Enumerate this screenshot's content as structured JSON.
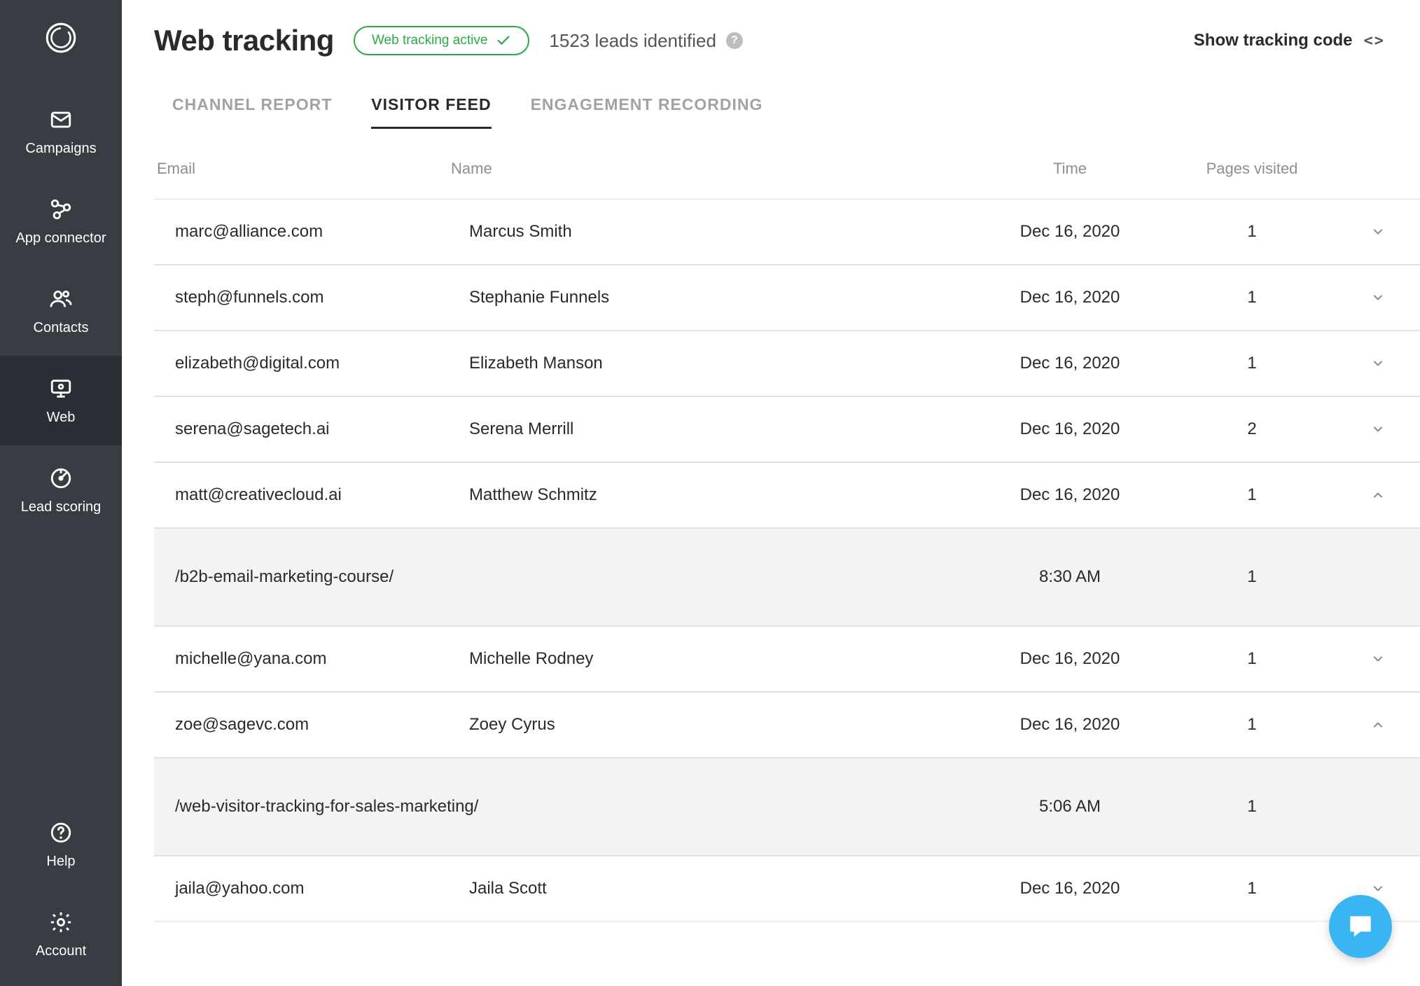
{
  "sidebar": {
    "items": [
      {
        "id": "campaigns",
        "label": "Campaigns"
      },
      {
        "id": "app-connector",
        "label": "App connector"
      },
      {
        "id": "contacts",
        "label": "Contacts"
      },
      {
        "id": "web",
        "label": "Web",
        "active": true
      },
      {
        "id": "lead-scoring",
        "label": "Lead scoring"
      }
    ],
    "bottom": [
      {
        "id": "help",
        "label": "Help"
      },
      {
        "id": "account",
        "label": "Account"
      }
    ]
  },
  "header": {
    "title": "Web tracking",
    "status_text": "Web tracking active",
    "leads_text": "1523 leads identified",
    "show_code_label": "Show tracking code"
  },
  "tabs": [
    {
      "id": "channel-report",
      "label": "CHANNEL REPORT"
    },
    {
      "id": "visitor-feed",
      "label": "VISITOR FEED",
      "active": true
    },
    {
      "id": "engagement-recording",
      "label": "ENGAGEMENT RECORDING"
    }
  ],
  "columns": {
    "email": "Email",
    "name": "Name",
    "time": "Time",
    "pages": "Pages visited"
  },
  "rows": [
    {
      "email": "marc@alliance.com",
      "name": "Marcus Smith",
      "time": "Dec 16, 2020",
      "pages": "1",
      "expanded": false
    },
    {
      "email": "steph@funnels.com",
      "name": "Stephanie Funnels",
      "time": "Dec 16, 2020",
      "pages": "1",
      "expanded": false
    },
    {
      "email": "elizabeth@digital.com",
      "name": "Elizabeth Manson",
      "time": "Dec 16, 2020",
      "pages": "1",
      "expanded": false
    },
    {
      "email": "serena@sagetech.ai",
      "name": "Serena Merrill",
      "time": "Dec 16, 2020",
      "pages": "2",
      "expanded": false
    },
    {
      "email": "matt@creativecloud.ai",
      "name": "Matthew Schmitz",
      "time": "Dec 16, 2020",
      "pages": "1",
      "expanded": true,
      "detail": {
        "path": "/b2b-email-marketing-course/",
        "time": "8:30 AM",
        "pages": "1"
      }
    },
    {
      "email": "michelle@yana.com",
      "name": "Michelle Rodney",
      "time": "Dec 16, 2020",
      "pages": "1",
      "expanded": false
    },
    {
      "email": "zoe@sagevc.com",
      "name": "Zoey Cyrus",
      "time": "Dec 16, 2020",
      "pages": "1",
      "expanded": true,
      "detail": {
        "path": "/web-visitor-tracking-for-sales-marketing/",
        "time": "5:06 AM",
        "pages": "1"
      }
    },
    {
      "email": "jaila@yahoo.com",
      "name": "Jaila Scott",
      "time": "Dec 16, 2020",
      "pages": "1",
      "expanded": false
    }
  ]
}
